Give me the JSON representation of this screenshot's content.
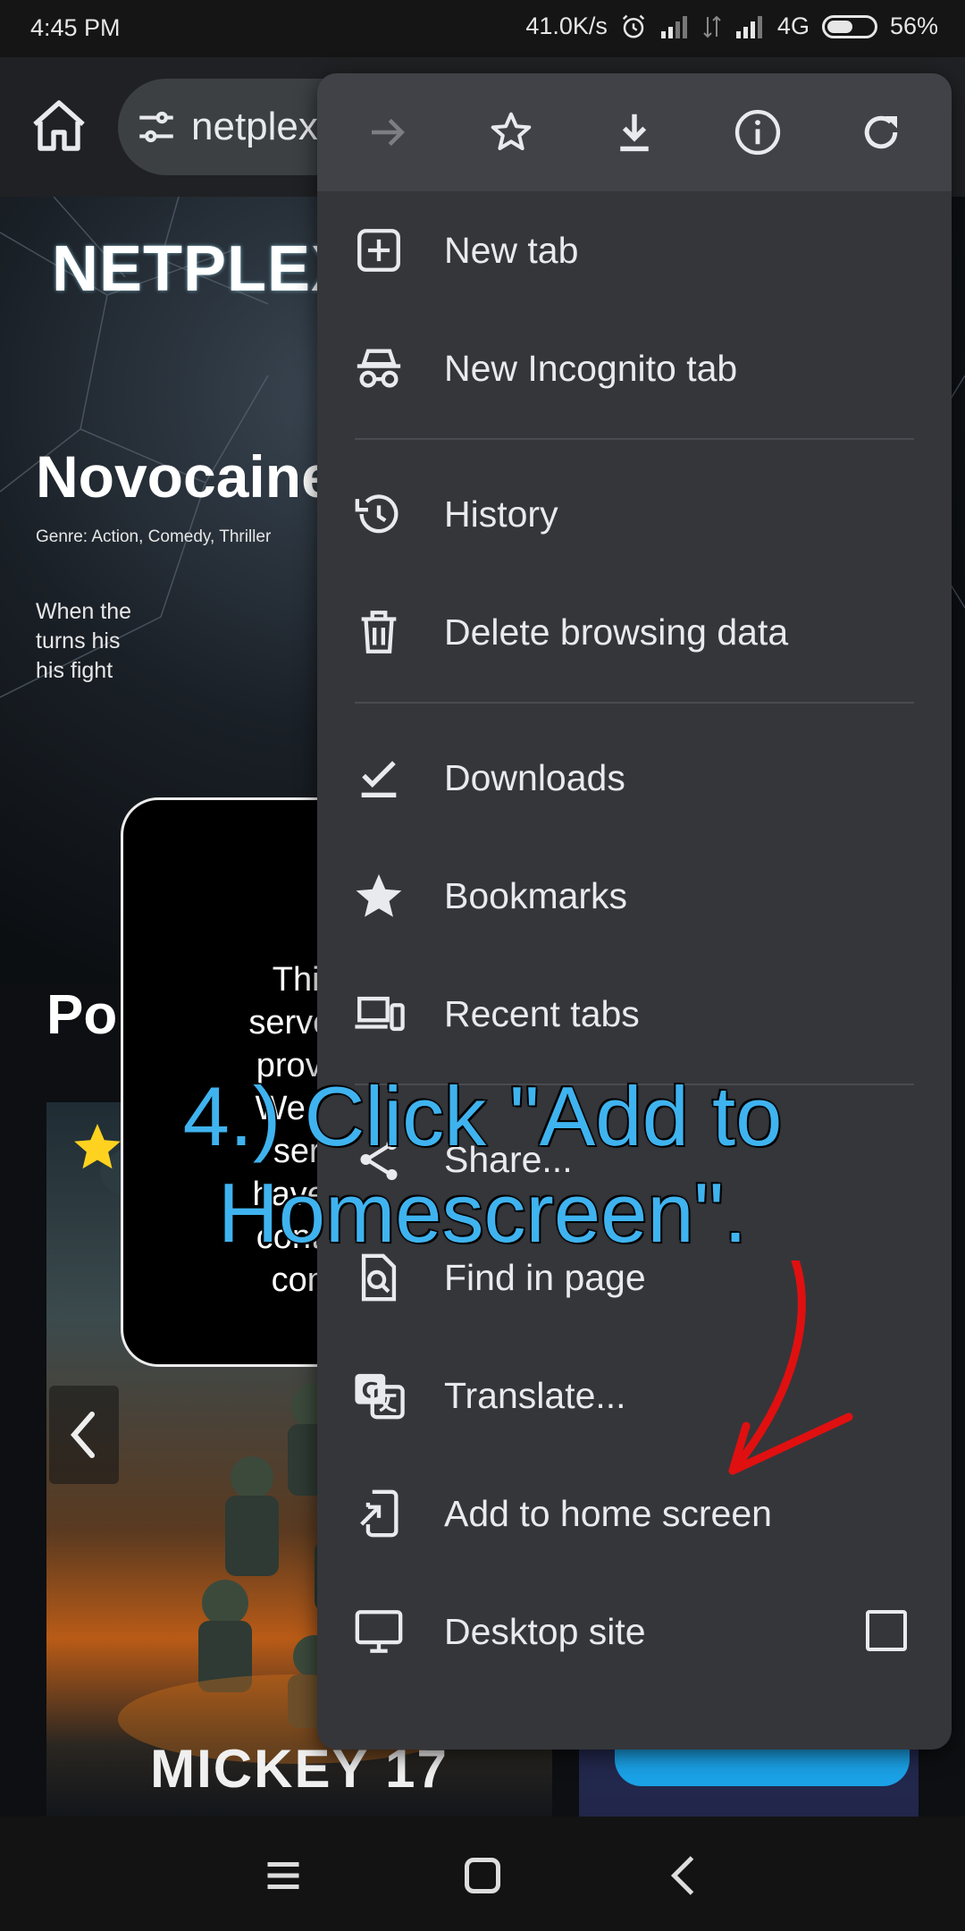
{
  "status_bar": {
    "time": "4:45 PM",
    "network_speed": "41.0K/s",
    "network_type": "4G",
    "battery": "56%",
    "battery_level": 0.56
  },
  "browser": {
    "url": "netplex",
    "menu": {
      "top_icons": [
        "forward-icon",
        "bookmark-star-icon",
        "download-icon",
        "info-icon",
        "reload-icon"
      ],
      "items": [
        {
          "label": "New tab",
          "icon": "new-tab-icon"
        },
        {
          "label": "New Incognito tab",
          "icon": "incognito-icon"
        },
        {
          "label": "History",
          "icon": "history-icon"
        },
        {
          "label": "Delete browsing data",
          "icon": "trash-icon"
        },
        {
          "label": "Downloads",
          "icon": "downloads-icon"
        },
        {
          "label": "Bookmarks",
          "icon": "bookmarks-icon"
        },
        {
          "label": "Recent tabs",
          "icon": "devices-icon"
        },
        {
          "label": "Share...",
          "icon": "share-icon"
        },
        {
          "label": "Find in page",
          "icon": "find-icon"
        },
        {
          "label": "Translate...",
          "icon": "translate-icon"
        },
        {
          "label": "Add to home screen",
          "icon": "add-to-home-icon"
        },
        {
          "label": "Desktop site",
          "icon": "desktop-icon",
          "checked": false
        }
      ]
    }
  },
  "page": {
    "logo": "NETPLEX",
    "movie_title": "Novocaine",
    "genre": "Genre: Action, Comedy, Thriller",
    "description_lines": [
      "When the",
      "turns his",
      "his fight"
    ],
    "section_title": "Po",
    "poster_title": "MICKEY 17",
    "dialog_lines": [
      "This site",
      "server. All c",
      "provided b",
      "We don't h",
      "services",
      "have any q",
      "content ho",
      "contact t"
    ]
  },
  "overlay": {
    "instruction_line1": "4.)  Click \"Add to",
    "instruction_line2": "Homescreen\"."
  },
  "colors": {
    "menu_bg": "#35363a",
    "menu_top_bg": "#414247",
    "instruction_text": "#3fb3ef",
    "arrow": "#e01010"
  }
}
